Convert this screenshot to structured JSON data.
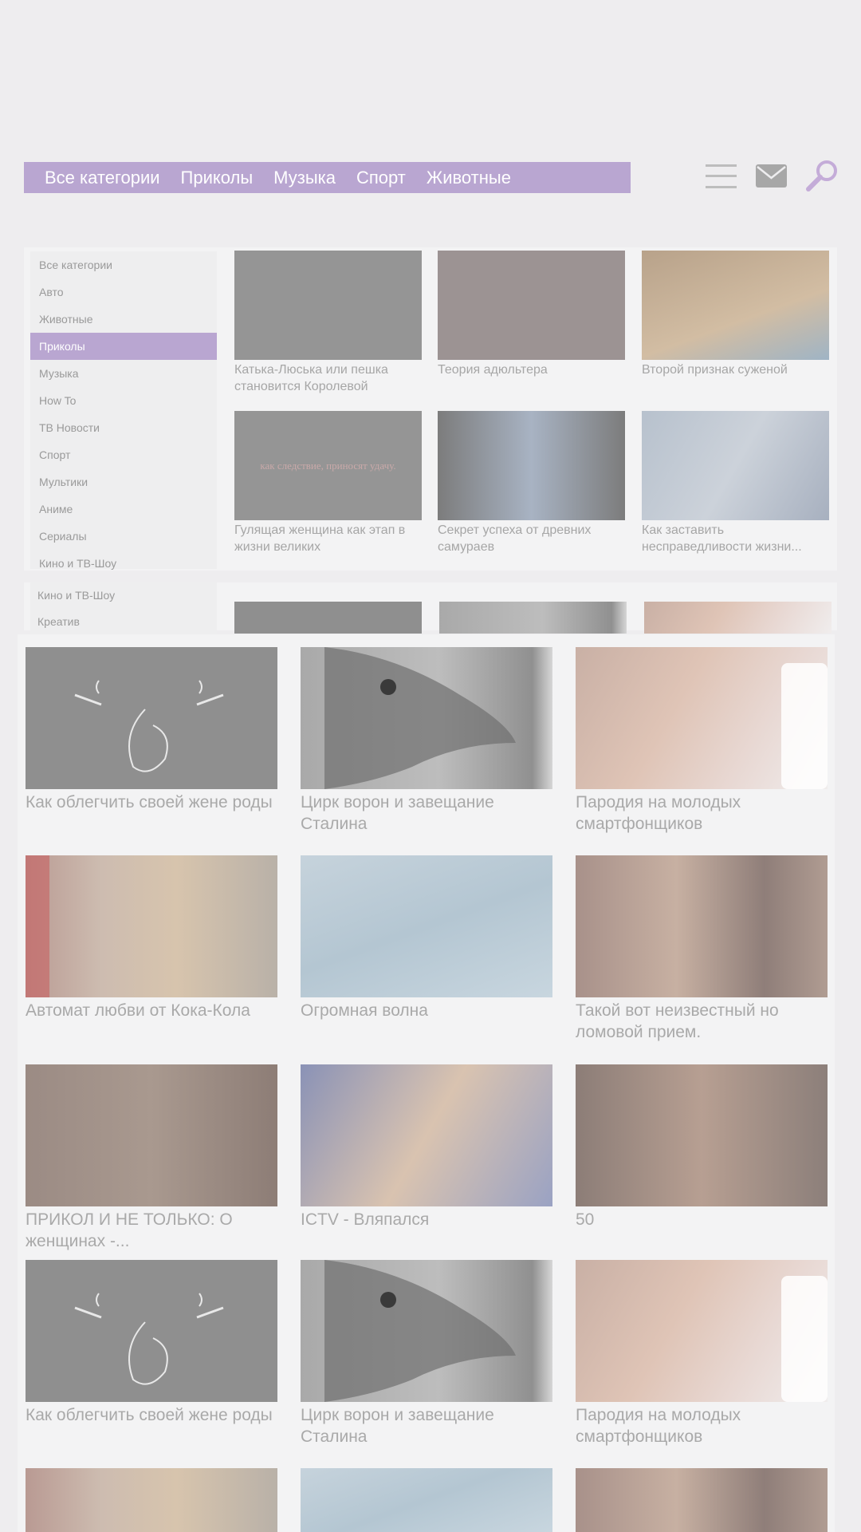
{
  "header": {
    "nav": [
      "Все категории",
      "Приколы",
      "Музыка",
      "Спорт",
      "Животные"
    ],
    "icons": [
      "menu-icon",
      "mail-icon",
      "search-icon"
    ],
    "accent_color": "#b9a6d1"
  },
  "sidebar": {
    "categories": [
      {
        "label": "Все категории",
        "active": false
      },
      {
        "label": "Авто",
        "active": false
      },
      {
        "label": "Животные",
        "active": false
      },
      {
        "label": "Приколы",
        "active": true
      },
      {
        "label": "Музыка",
        "active": false
      },
      {
        "label": "How To",
        "active": false
      },
      {
        "label": "ТВ Новости",
        "active": false
      },
      {
        "label": "Спорт",
        "active": false
      },
      {
        "label": "Мультики",
        "active": false
      },
      {
        "label": "Аниме",
        "active": false
      },
      {
        "label": "Сериалы",
        "active": false
      },
      {
        "label": "Кино и ТВ-Шоу",
        "active": false
      }
    ],
    "categories_second": [
      "Кино и ТВ-Шоу",
      "Креатив"
    ]
  },
  "top_videos": [
    {
      "title": "Катька-Люська или пешка становится Королевой"
    },
    {
      "title": "Теория адюльтера"
    },
    {
      "title": "Второй признак суженой"
    },
    {
      "title": "Гулящая женщина как этап в жизни великих"
    },
    {
      "title": "Секрет успеха от древних самураев"
    },
    {
      "title": "Как заставить несправедливости жизни..."
    }
  ],
  "thumb_text": {
    "video2": "как следствие, приносят удачу."
  },
  "videos": [
    {
      "title": "Как облегчить своей жене роды"
    },
    {
      "title": "Цирк ворон и завещание Сталина"
    },
    {
      "title": "Пародия на молодых смартфонщиков"
    },
    {
      "title": "Автомат любви от Кока-Кола"
    },
    {
      "title": "Огромная волна"
    },
    {
      "title": "Такой вот неизвестный но ломовой прием."
    },
    {
      "title": "ПРИКОЛ И НЕ ТОЛЬКО: О женщинах -..."
    },
    {
      "title": "ICTV - Вляпался"
    },
    {
      "title": "50"
    },
    {
      "title": "Как облегчить своей жене роды"
    },
    {
      "title": "Цирк ворон и завещание Сталина"
    },
    {
      "title": "Пародия на молодых смартфонщиков"
    }
  ]
}
